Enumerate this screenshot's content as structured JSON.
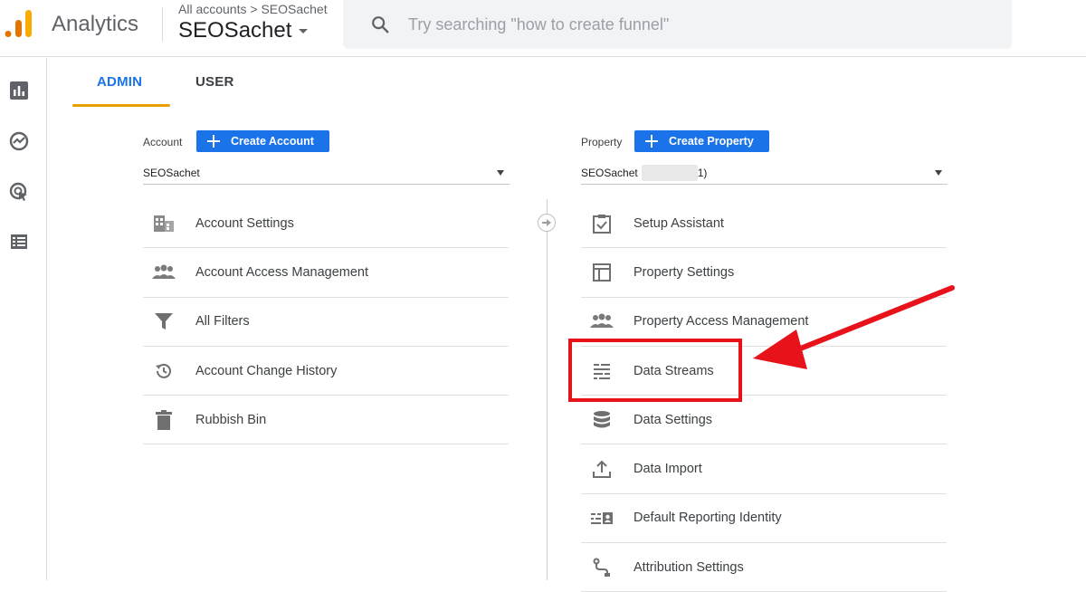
{
  "header": {
    "app_name": "Analytics",
    "breadcrumb": "All accounts > SEOSachet",
    "property_name": "SEOSachet",
    "search_placeholder": "Try searching \"how to create funnel\""
  },
  "rail": {
    "items": [
      {
        "icon": "reports-icon"
      },
      {
        "icon": "explore-icon"
      },
      {
        "icon": "advertising-icon"
      },
      {
        "icon": "configure-icon"
      }
    ]
  },
  "tabs": [
    {
      "label": "ADMIN",
      "active": true
    },
    {
      "label": "USER",
      "active": false
    }
  ],
  "account": {
    "label": "Account",
    "create_label": "Create Account",
    "selected": "SEOSachet",
    "menu": [
      {
        "label": "Account Settings",
        "icon": "building-icon"
      },
      {
        "label": "Account Access Management",
        "icon": "people-icon"
      },
      {
        "label": "All Filters",
        "icon": "filter-icon"
      },
      {
        "label": "Account Change History",
        "icon": "history-icon"
      },
      {
        "label": "Rubbish Bin",
        "icon": "trash-icon"
      }
    ]
  },
  "property": {
    "label": "Property",
    "create_label": "Create Property",
    "selected_prefix": "SEOSachet",
    "selected_suffix": "1)",
    "menu": [
      {
        "label": "Setup Assistant",
        "icon": "checklist-icon"
      },
      {
        "label": "Property Settings",
        "icon": "layout-icon"
      },
      {
        "label": "Property Access Management",
        "icon": "people-icon"
      },
      {
        "label": "Data Streams",
        "icon": "streams-icon"
      },
      {
        "label": "Data Settings",
        "icon": "database-icon"
      },
      {
        "label": "Data Import",
        "icon": "upload-icon"
      },
      {
        "label": "Default Reporting Identity",
        "icon": "identity-icon"
      },
      {
        "label": "Attribution Settings",
        "icon": "attribution-icon"
      }
    ]
  },
  "annotation": {
    "highlight_color": "#e8121a",
    "target": "Data Streams"
  },
  "colors": {
    "accent": "#1a73e8",
    "tab_underline": "#e8a100"
  }
}
